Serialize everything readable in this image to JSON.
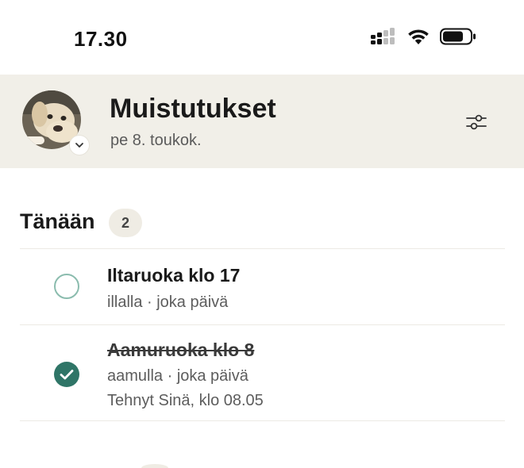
{
  "status_bar": {
    "time": "17.30",
    "icons": [
      "cellular-signal-icon",
      "wifi-icon",
      "battery-icon"
    ]
  },
  "header": {
    "title": "Muistutukset",
    "date": "pe 8. toukok.",
    "avatar": "dog-avatar",
    "filter_icon": "sliders-icon"
  },
  "section": {
    "title": "Tänään",
    "count": "2"
  },
  "reminders": [
    {
      "title": "Iltaruoka klo 17",
      "meta": "illalla · joka päivä",
      "done": false
    },
    {
      "title": "Aamuruoka klo 8",
      "meta": "aamulla · joka päivä",
      "done_by": "Tehnyt Sinä, klo 08.05",
      "done": true
    }
  ],
  "colors": {
    "header_bg": "#f1efe8",
    "accent": "#2f7567",
    "open_circle": "#8bbcae",
    "badge_bg": "#efece4"
  }
}
